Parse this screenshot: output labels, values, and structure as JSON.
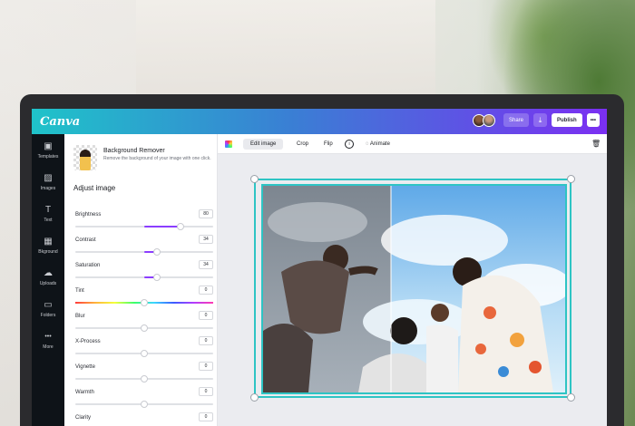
{
  "app": {
    "logo": "Canva"
  },
  "topbar": {
    "share_label": "Share",
    "download_icon": "download-icon",
    "publish_label": "Publish",
    "more_label": "•••"
  },
  "rail": {
    "items": [
      {
        "label": "Templates",
        "icon": "templates-icon",
        "glyph": "▣"
      },
      {
        "label": "Images",
        "icon": "images-icon",
        "glyph": "▨"
      },
      {
        "label": "Text",
        "icon": "text-icon",
        "glyph": "T"
      },
      {
        "label": "Bkground",
        "icon": "background-icon",
        "glyph": "▦"
      },
      {
        "label": "Uploads",
        "icon": "upload-icon",
        "glyph": "☁"
      },
      {
        "label": "Folders",
        "icon": "folder-icon",
        "glyph": "▭"
      },
      {
        "label": "More",
        "icon": "more-icon",
        "glyph": "•••"
      }
    ]
  },
  "panel": {
    "bg_remover_title": "Background Remover",
    "bg_remover_desc": "Remove the background of your image with one click.",
    "adjust_title": "Adjust image",
    "adjustments": [
      {
        "label": "Brightness",
        "value": "80"
      },
      {
        "label": "Contrast",
        "value": "34"
      },
      {
        "label": "Saturation",
        "value": "34"
      },
      {
        "label": "Tint",
        "value": "0"
      },
      {
        "label": "Blur",
        "value": "0"
      },
      {
        "label": "X-Process",
        "value": "0"
      },
      {
        "label": "Vignette",
        "value": "0"
      },
      {
        "label": "Warmth",
        "value": "0"
      },
      {
        "label": "Clarity",
        "value": "0"
      }
    ]
  },
  "toolbar": {
    "edit_image_label": "Edit image",
    "crop_label": "Crop",
    "flip_label": "Flip",
    "info_glyph": "i",
    "animate_label": "Animate",
    "trash_icon": "trash-icon"
  },
  "colors": {
    "accent": "#8b3dff",
    "selection": "#2ec4c4",
    "topbar_start": "#1fc3c9",
    "topbar_end": "#7b2ff2"
  }
}
